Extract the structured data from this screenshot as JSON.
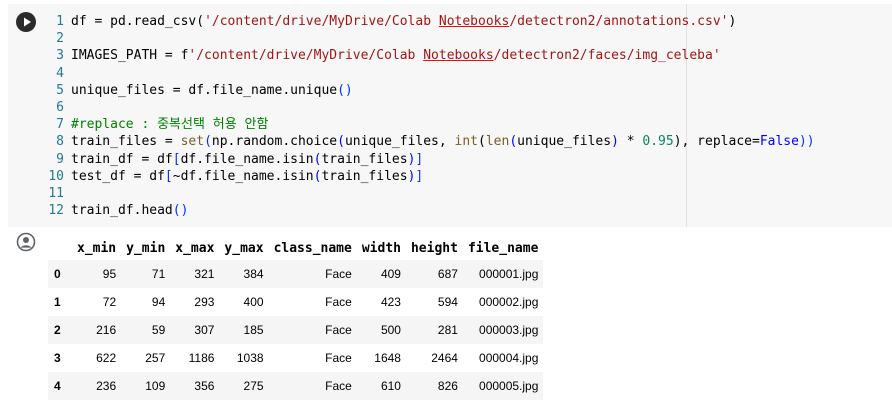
{
  "code_cell": {
    "lines": [
      {
        "n": "1",
        "tokens": [
          {
            "t": "df = pd.read_csv(",
            "c": "t"
          },
          {
            "t": "'/content/drive/MyDrive/Colab",
            "c": "s"
          },
          {
            "t": " ",
            "c": "s"
          },
          {
            "t": "Notebooks",
            "c": "s u"
          },
          {
            "t": "/detectron2/annotations.csv'",
            "c": "s"
          },
          {
            "t": ")",
            "c": "t"
          }
        ]
      },
      {
        "n": "2",
        "tokens": []
      },
      {
        "n": "3",
        "tokens": [
          {
            "t": "IMAGES_PATH = f",
            "c": "t"
          },
          {
            "t": "'/content/drive/MyDrive/Colab",
            "c": "s"
          },
          {
            "t": " ",
            "c": "s"
          },
          {
            "t": "Notebooks",
            "c": "s u"
          },
          {
            "t": "/detectron2/faces/img_celeba'",
            "c": "s"
          }
        ]
      },
      {
        "n": "4",
        "tokens": []
      },
      {
        "n": "5",
        "tokens": [
          {
            "t": "unique_files = df.file_name.unique",
            "c": "t"
          },
          {
            "t": "()",
            "c": "br1"
          }
        ]
      },
      {
        "n": "6",
        "tokens": []
      },
      {
        "n": "7",
        "tokens": [
          {
            "t": "#replace : 중복선택 허용 안함",
            "c": "cm"
          }
        ]
      },
      {
        "n": "8",
        "tokens": [
          {
            "t": "train_files = ",
            "c": "t"
          },
          {
            "t": "set",
            "c": "f"
          },
          {
            "t": "(",
            "c": "br1"
          },
          {
            "t": "np.random.choice",
            "c": "t"
          },
          {
            "t": "(",
            "c": "k"
          },
          {
            "t": "unique_files, ",
            "c": "t"
          },
          {
            "t": "int",
            "c": "f"
          },
          {
            "t": "(",
            "c": "t"
          },
          {
            "t": "len",
            "c": "f"
          },
          {
            "t": "(",
            "c": "k"
          },
          {
            "t": "unique_files",
            "c": "t"
          },
          {
            "t": ")",
            "c": "k"
          },
          {
            "t": " * ",
            "c": "t"
          },
          {
            "t": "0.95",
            "c": "nm"
          },
          {
            "t": ")",
            "c": "t"
          },
          {
            "t": ", replace=",
            "c": "t"
          },
          {
            "t": "False",
            "c": "k"
          },
          {
            "t": "))",
            "c": "br1"
          }
        ]
      },
      {
        "n": "9",
        "tokens": [
          {
            "t": "train_df = df",
            "c": "t"
          },
          {
            "t": "[",
            "c": "br1"
          },
          {
            "t": "df.file_name.isin",
            "c": "t"
          },
          {
            "t": "(",
            "c": "k"
          },
          {
            "t": "train_files",
            "c": "t"
          },
          {
            "t": ")",
            "c": "k"
          },
          {
            "t": "]",
            "c": "br1"
          }
        ]
      },
      {
        "n": "10",
        "tokens": [
          {
            "t": "test_df = df",
            "c": "t"
          },
          {
            "t": "[",
            "c": "br1"
          },
          {
            "t": "~df.file_name.isin",
            "c": "t"
          },
          {
            "t": "(",
            "c": "k"
          },
          {
            "t": "train_files",
            "c": "t"
          },
          {
            "t": ")",
            "c": "k"
          },
          {
            "t": "]",
            "c": "br1"
          }
        ]
      },
      {
        "n": "11",
        "tokens": []
      },
      {
        "n": "12",
        "tokens": [
          {
            "t": "train_df.head",
            "c": "t"
          },
          {
            "t": "()",
            "c": "br1"
          }
        ]
      }
    ]
  },
  "icons": {
    "run": "play-icon",
    "output": "user-avatar-icon"
  },
  "output_table": {
    "columns": [
      "",
      "x_min",
      "y_min",
      "x_max",
      "y_max",
      "class_name",
      "width",
      "height",
      "file_name"
    ],
    "rows": [
      [
        "0",
        "95",
        "71",
        "321",
        "384",
        "Face",
        "409",
        "687",
        "000001.jpg"
      ],
      [
        "1",
        "72",
        "94",
        "293",
        "400",
        "Face",
        "423",
        "594",
        "000002.jpg"
      ],
      [
        "2",
        "216",
        "59",
        "307",
        "185",
        "Face",
        "500",
        "281",
        "000003.jpg"
      ],
      [
        "3",
        "622",
        "257",
        "1186",
        "1038",
        "Face",
        "1648",
        "2464",
        "000004.jpg"
      ],
      [
        "4",
        "236",
        "109",
        "356",
        "275",
        "Face",
        "610",
        "826",
        "000005.jpg"
      ]
    ]
  }
}
